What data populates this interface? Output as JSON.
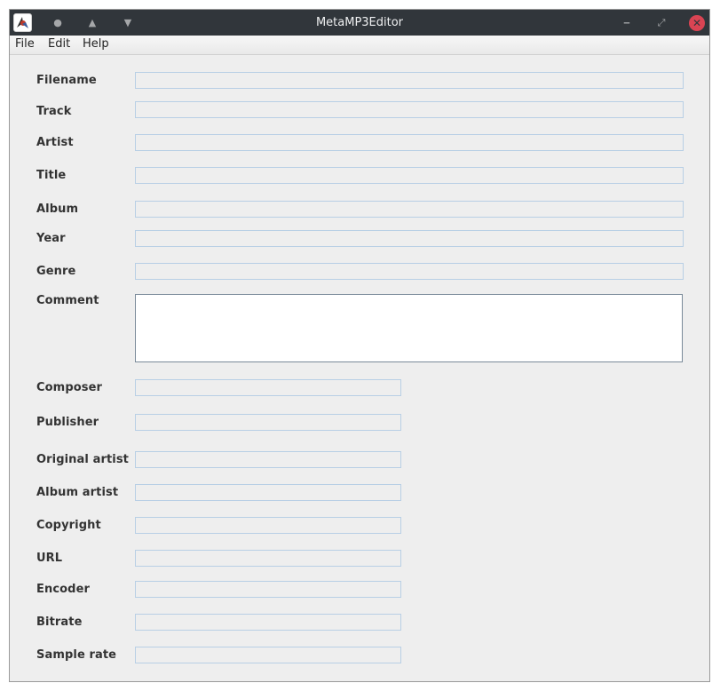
{
  "window": {
    "title": "MetaMP3Editor"
  },
  "titlebar": {
    "icons": [
      "app-icon",
      "pin-icon",
      "keep-above-icon",
      "keep-below-icon",
      "minimize-icon",
      "maximize-icon",
      "close-icon"
    ],
    "glyphs": {
      "pin": "●",
      "keep_above": "▲",
      "keep_below": "▼",
      "minimize": "‒",
      "maximize": "⤢",
      "close": "✕"
    },
    "close_color": "#da4453",
    "bar_color": "#31363b"
  },
  "menubar": {
    "items": [
      {
        "label": "File"
      },
      {
        "label": "Edit"
      },
      {
        "label": "Help"
      }
    ]
  },
  "form": {
    "fields": [
      {
        "label": "Filename",
        "value": ""
      },
      {
        "label": "Track",
        "value": ""
      },
      {
        "label": "Artist",
        "value": ""
      },
      {
        "label": "Title",
        "value": ""
      },
      {
        "label": "Album",
        "value": ""
      },
      {
        "label": "Year",
        "value": ""
      },
      {
        "label": "Genre",
        "value": ""
      },
      {
        "label": "Comment",
        "value": ""
      },
      {
        "label": "Composer",
        "value": ""
      },
      {
        "label": "Publisher",
        "value": ""
      },
      {
        "label": "Original artist",
        "value": ""
      },
      {
        "label": "Album artist",
        "value": ""
      },
      {
        "label": "Copyright",
        "value": ""
      },
      {
        "label": "URL",
        "value": ""
      },
      {
        "label": "Encoder",
        "value": ""
      },
      {
        "label": "Bitrate",
        "value": ""
      },
      {
        "label": "Sample rate",
        "value": ""
      }
    ]
  },
  "colors": {
    "window_bg": "#eeeeee",
    "field_border": "#b8cfe5",
    "label_text": "#333333"
  }
}
